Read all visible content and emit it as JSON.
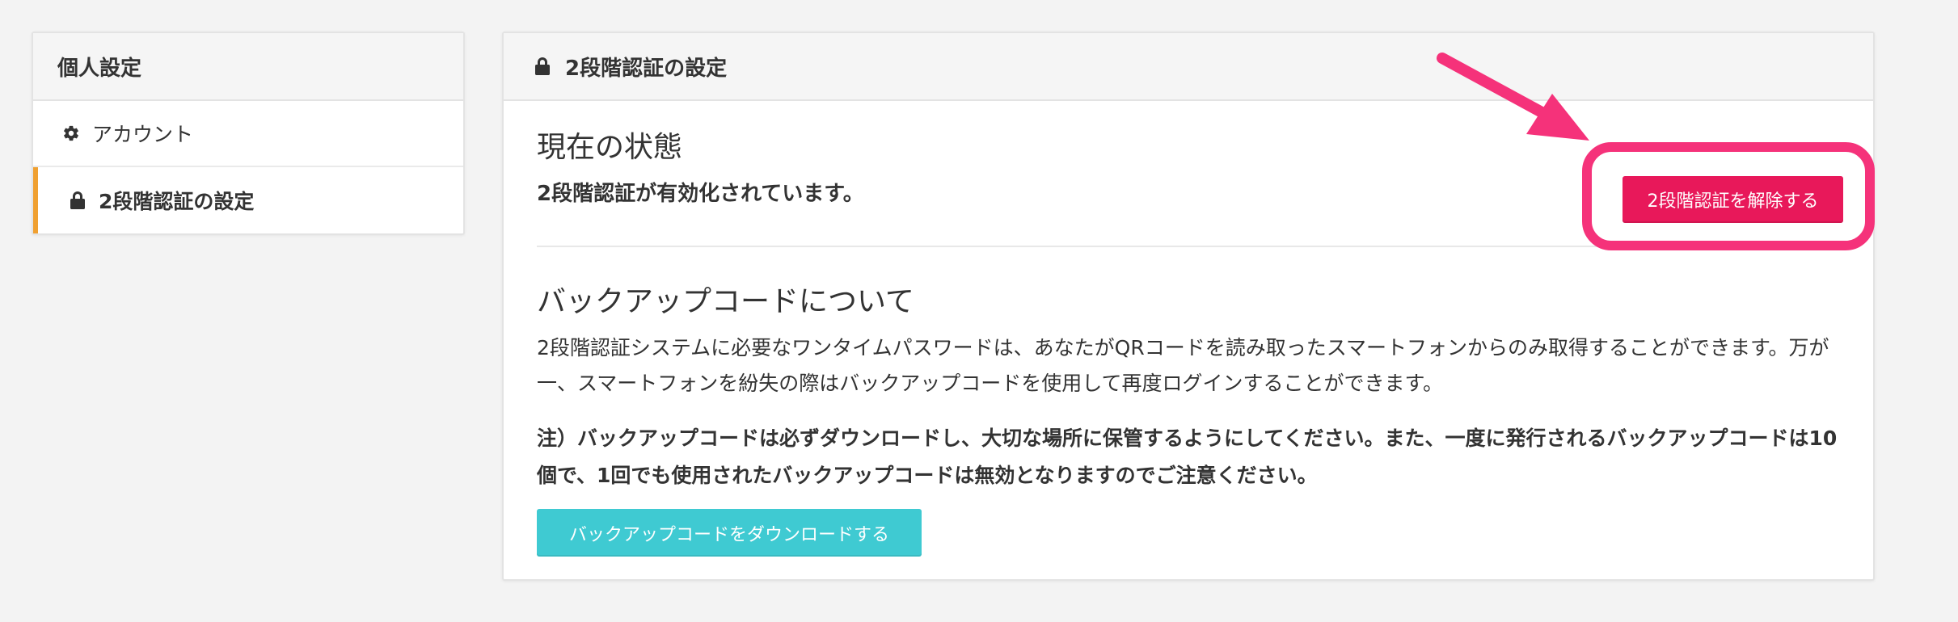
{
  "sidebar": {
    "title": "個人設定",
    "items": [
      {
        "icon": "gear-icon",
        "label": "アカウント"
      },
      {
        "icon": "lock-icon",
        "label": "2段階認証の設定"
      }
    ]
  },
  "panel": {
    "icon": "lock-icon",
    "title": "2段階認証の設定",
    "status_heading": "現在の状態",
    "status_text": "2段階認証が有効化されています。",
    "disable_button_label": "2段階認証を解除する",
    "backup_heading": "バックアップコードについて",
    "backup_description": "2段階認証システムに必要なワンタイムパスワードは、あなたがQRコードを読み取ったスマートフォンからのみ取得することができます。万が一、スマートフォンを紛失の際はバックアップコードを使用して再度ログインすることができます。",
    "backup_note": "注）バックアップコードは必ずダウンロードし、大切な場所に保管するようにしてください。また、一度に発行されるバックアップコードは10個で、1回でも使用されたバックアップコードは無効となりますのでご注意ください。",
    "download_button_label": "バックアップコードをダウンロードする"
  },
  "colors": {
    "accent_active": "#f0a030",
    "disable_button": "#e8185a",
    "download_button": "#3fcad2",
    "annotation": "#f5327a"
  }
}
